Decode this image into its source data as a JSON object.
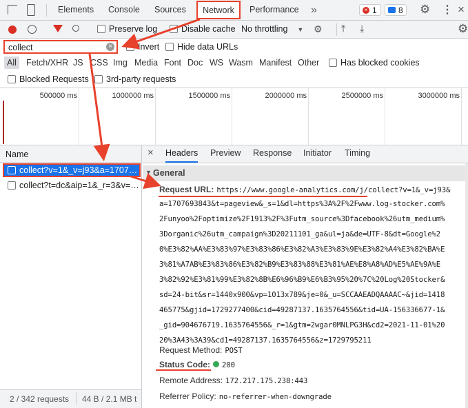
{
  "tabs": [
    "Elements",
    "Console",
    "Sources",
    "Network",
    "Performance"
  ],
  "more_tabs": "»",
  "error_count": "1",
  "message_count": "8",
  "toolbar": {
    "preserve_log": "Preserve log",
    "disable_cache": "Disable cache",
    "throttling": "No throttling"
  },
  "filter": {
    "value": "collect",
    "invert": "Invert",
    "hide_data_urls": "Hide data URLs"
  },
  "types": [
    "All",
    "Fetch/XHR",
    "JS",
    "CSS",
    "Img",
    "Media",
    "Font",
    "Doc",
    "WS",
    "Wasm",
    "Manifest",
    "Other"
  ],
  "has_blocked_cookies": "Has blocked cookies",
  "blocked_requests": "Blocked Requests",
  "third_party": "3rd-party requests",
  "timeline_ticks": [
    "500000 ms",
    "1000000 ms",
    "1500000 ms",
    "2000000 ms",
    "2500000 ms",
    "3000000 ms"
  ],
  "name_header": "Name",
  "requests": [
    "collect?v=1&_v=j93&a=1707…",
    "collect?t=dc&aip=1&_r=3&v=…"
  ],
  "footer": {
    "count": "2 / 342 requests",
    "size": "44 B / 2.1 MB t"
  },
  "detail_tabs": [
    "Headers",
    "Preview",
    "Response",
    "Initiator",
    "Timing"
  ],
  "general": "General",
  "request_url_label": "Request URL:",
  "request_url_lines": [
    "https://www.google-analytics.com/j/collect?v=1&_v=j93&",
    "a=1707693843&t=pageview&_s=1&dl=https%3A%2F%2Fwww.log-stocker.com%",
    "2Funyoo%2Foptimize%2F1913%2F%3Futm_source%3Dfacebook%26utm_medium%",
    "3Dorganic%26utm_campaign%3D20211101_ga&ul=ja&de=UTF-8&dt=Google%2",
    "0%E3%82%AA%E3%83%97%E3%83%86%E3%82%A3%E3%83%9E%E3%82%A4%E3%82%BA%E",
    "3%81%A7AB%E3%83%86%E3%82%B9%E3%83%88%E3%81%AE%E8%A8%AD%E5%AE%9A%E",
    "3%82%92%E3%81%99%E3%82%8B%E6%96%B9%E6%B3%95%20%7C%20Log%20Stocker&",
    "sd=24-bit&sr=1440x900&vp=1013x789&je=0&_u=SCCAAEADQAAAAC~&jid=1418",
    "465775&gjid=1729277400&cid=49287137.1635764556&tid=UA-156336677-1&",
    "_gid=904676719.1635764556&_r=1&gtm=2wgar0MNLPG3H&cd2=2021-11-01%20",
    "20%3A43%3A39&cd1=49287137.1635764556&z=1729795211"
  ],
  "request_method": {
    "label": "Request Method:",
    "value": "POST"
  },
  "status_code": {
    "label": "Status Code:",
    "value": "200"
  },
  "remote_address": {
    "label": "Remote Address:",
    "value": "172.217.175.238:443"
  },
  "referrer_policy": {
    "label": "Referrer Policy:",
    "value": "no-referrer-when-downgrade"
  },
  "colors": {
    "annotation": "#e8412c",
    "selection": "#1a73e8",
    "status_ok": "#34a853"
  }
}
